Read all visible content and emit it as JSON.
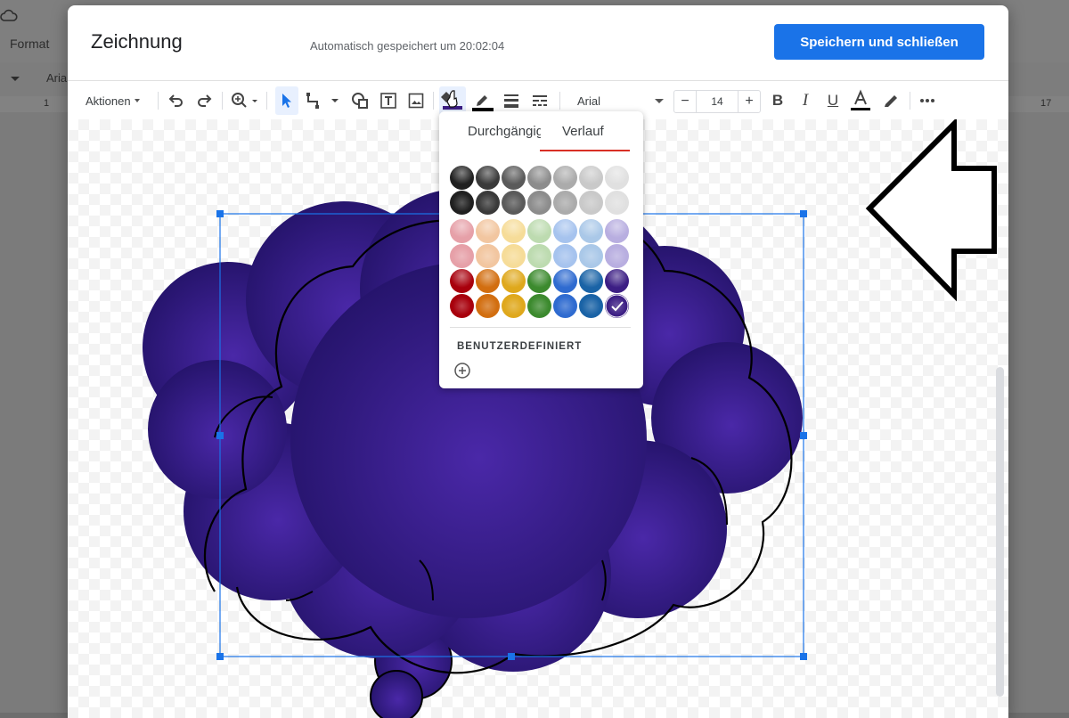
{
  "background_doc": {
    "menu_format": "Format",
    "font_fragment": "Aria",
    "ruler_left": "1",
    "ruler_right": "17"
  },
  "dialog": {
    "title": "Zeichnung",
    "status": "Automatisch gespeichert um 20:02:04",
    "save_label": "Speichern und schließen"
  },
  "toolbar": {
    "actions_label": "Aktionen",
    "font": "Arial",
    "font_size": "14",
    "decrease": "−",
    "increase": "+",
    "text_color_bar": "#000000",
    "line_color_bar": "#000000"
  },
  "color_popup": {
    "tab_solid": "Durchgängig",
    "tab_gradient": "Verlauf",
    "active_tab": "Verlauf",
    "custom_label": "BENUTZERDEFINIERT",
    "selected_color": "#3c1e84",
    "gradient_rows": [
      [
        "#202020",
        "#3a3a3a",
        "#5a5a5a",
        "#8c8c8c",
        "#ababab",
        "#c9c9c9",
        "#e0e0e0"
      ],
      [
        "#202020",
        "#3a3a3a",
        "#5a5a5a",
        "#8c8c8c",
        "#ababab",
        "#c9c9c9",
        "#e0e0e0"
      ],
      [
        "#e6a0a8",
        "#f2c6a0",
        "#f6dc98",
        "#bddbb0",
        "#a6c3ee",
        "#aac8e8",
        "#b8aee0"
      ],
      [
        "#e6a0a8",
        "#f2c6a0",
        "#f6dc98",
        "#bddbb0",
        "#a6c3ee",
        "#aac8e8",
        "#b8aee0"
      ],
      [
        "#a8000c",
        "#d26e10",
        "#dfa81c",
        "#3c8a2e",
        "#2f6bd0",
        "#1a63a6",
        "#3c1e84"
      ],
      [
        "#a8000c",
        "#d26e10",
        "#dfa81c",
        "#3c8a2e",
        "#2f6bd0",
        "#1a63a6",
        "#3c1e84"
      ]
    ]
  },
  "canvas": {
    "cloud_fill_center": "#4a28a8",
    "cloud_fill_edge": "#221266",
    "selection_color": "#1a73e8"
  }
}
